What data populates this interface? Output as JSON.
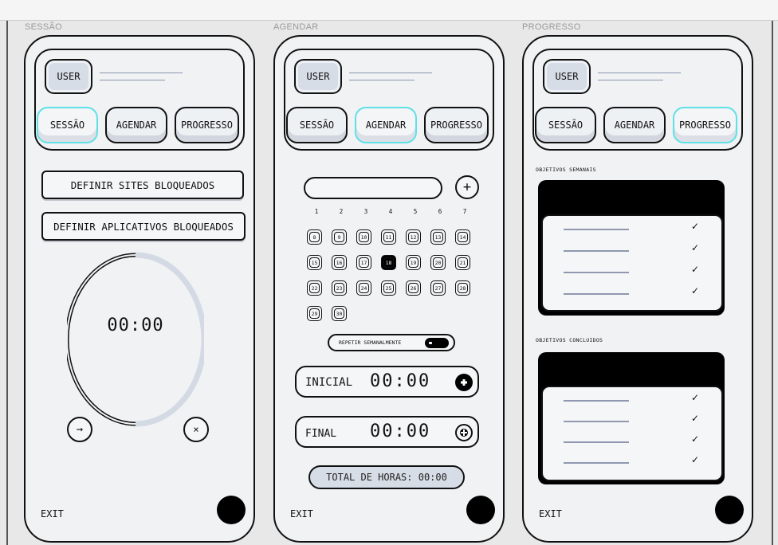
{
  "columns": [
    {
      "label": "SESSÃO"
    },
    {
      "label": "AGENDAR"
    },
    {
      "label": "PROGRESSO"
    }
  ],
  "header": {
    "user_label": "USER",
    "tabs": [
      "SESSÃO",
      "AGENDAR",
      "PROGRESSO"
    ]
  },
  "exit_label": "EXIT",
  "session": {
    "active_tab": "SESSÃO",
    "block_sites_label": "DEFINIR SITES BLOQUEADOS",
    "block_apps_label": "DEFINIR APLICATIVOS BLOQUEADOS",
    "timer": "00:00",
    "timer_progress": 0.5,
    "start_icon": "arrow-right-icon",
    "cancel_icon": "close-icon"
  },
  "schedule": {
    "active_tab": "AGENDAR",
    "week_days": [
      "1",
      "2",
      "3",
      "4",
      "5",
      "6",
      "7"
    ],
    "calendar_days": [
      "8",
      "9",
      "10",
      "11",
      "12",
      "13",
      "14",
      "15",
      "16",
      "17",
      "18",
      "19",
      "20",
      "21",
      "22",
      "23",
      "24",
      "25",
      "26",
      "27",
      "28",
      "29",
      "30"
    ],
    "selected_day": "18",
    "repeat_label": "REPETIR SEMANALMENTE",
    "repeat_enabled": true,
    "start_label": "INICIAL",
    "start_time": "00:00",
    "end_label": "FINAL",
    "end_time": "00:00",
    "total_label": "TOTAL DE HORAS: 00:00"
  },
  "progress": {
    "active_tab": "PROGRESSO",
    "weekly_title": "OBJETIVOS SEMANAIS",
    "completed_title": "OBJETIVOS CONCLUIDOS",
    "weekly_items": 4,
    "completed_items": 4,
    "check_mark": "✓"
  },
  "colors": {
    "active_tab_border": "#5fe0e6",
    "background": "#e8e8e8",
    "screen": "#f0f2f4",
    "accent_fill": "#d7dde6"
  }
}
